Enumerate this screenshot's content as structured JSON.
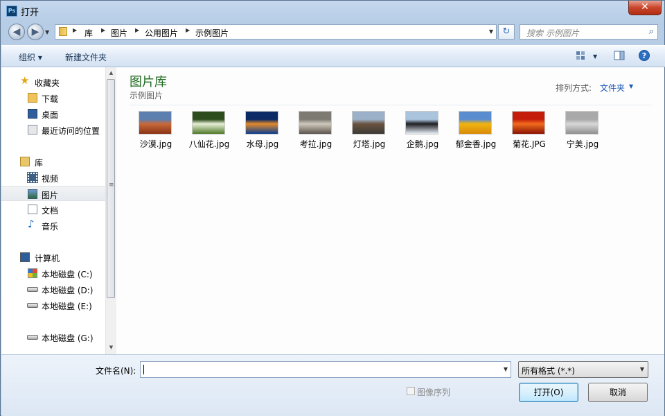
{
  "window": {
    "title": "打开",
    "app_icon_text": "Ps",
    "close_symbol": "✕"
  },
  "nav": {
    "back_symbol": "◀",
    "forward_symbol": "▶",
    "breadcrumb": [
      "库",
      "图片",
      "公用图片",
      "示例图片"
    ],
    "refresh_symbol": "↻",
    "search_placeholder": "搜索 示例图片"
  },
  "toolbar": {
    "organize_label": "组织 ▾",
    "new_folder_label": "新建文件夹"
  },
  "sidebar": {
    "favorites": {
      "label": "收藏夹",
      "icon": "star-icon"
    },
    "favorites_items": [
      {
        "label": "下载",
        "icon": "download-folder-icon"
      },
      {
        "label": "桌面",
        "icon": "desktop-icon"
      },
      {
        "label": "最近访问的位置",
        "icon": "recent-places-icon"
      }
    ],
    "libraries": {
      "label": "库",
      "icon": "library-icon"
    },
    "library_items": [
      {
        "label": "视频",
        "icon": "video-icon"
      },
      {
        "label": "图片",
        "icon": "pictures-icon",
        "selected": true
      },
      {
        "label": "文档",
        "icon": "documents-icon"
      },
      {
        "label": "音乐",
        "icon": "music-icon"
      }
    ],
    "computer": {
      "label": "计算机",
      "icon": "computer-icon"
    },
    "drives": [
      {
        "label": "本地磁盘 (C:)",
        "icon": "windows-drive-icon"
      },
      {
        "label": "本地磁盘 (D:)",
        "icon": "drive-icon"
      },
      {
        "label": "本地磁盘 (E:)",
        "icon": "drive-icon"
      },
      {
        "label": "本地磁盘 (G:)",
        "icon": "drive-icon"
      }
    ]
  },
  "main": {
    "library_title": "图片库",
    "library_subtitle": "示例图片",
    "arrange_label": "排列方式:",
    "arrange_value": "文件夹",
    "files": [
      {
        "name": "沙漠.jpg",
        "colors": [
          "#5d7fb0",
          "#c8693a",
          "#8a3415"
        ]
      },
      {
        "name": "八仙花.jpg",
        "colors": [
          "#2e4d1c",
          "#e8f0d8",
          "#4f7a2a"
        ]
      },
      {
        "name": "水母.jpg",
        "colors": [
          "#0c2a66",
          "#e28a2c",
          "#0a3d8f"
        ]
      },
      {
        "name": "考拉.jpg",
        "colors": [
          "#7d7a72",
          "#cfc9bd",
          "#5a544b"
        ]
      },
      {
        "name": "灯塔.jpg",
        "colors": [
          "#9bb0c9",
          "#6b5440",
          "#3c3a35"
        ]
      },
      {
        "name": "企鹅.jpg",
        "colors": [
          "#aac4de",
          "#1e1e22",
          "#e6eef6"
        ]
      },
      {
        "name": "郁金香.jpg",
        "colors": [
          "#5a8cd0",
          "#f0b410",
          "#d98a0a"
        ]
      },
      {
        "name": "菊花.JPG",
        "colors": [
          "#c41e0a",
          "#f26b1d",
          "#8a1305"
        ]
      },
      {
        "name": "宁美.jpg",
        "colors": [
          "#a9a9a9",
          "#d8d8d8",
          "#8f8f8f"
        ]
      }
    ]
  },
  "bottom": {
    "filename_label": "文件名(N):",
    "filename_value": "",
    "filetype_value": "所有格式 (*.*)",
    "sequence_label": "图像序列",
    "open_label": "打开(O)",
    "cancel_label": "取消"
  }
}
